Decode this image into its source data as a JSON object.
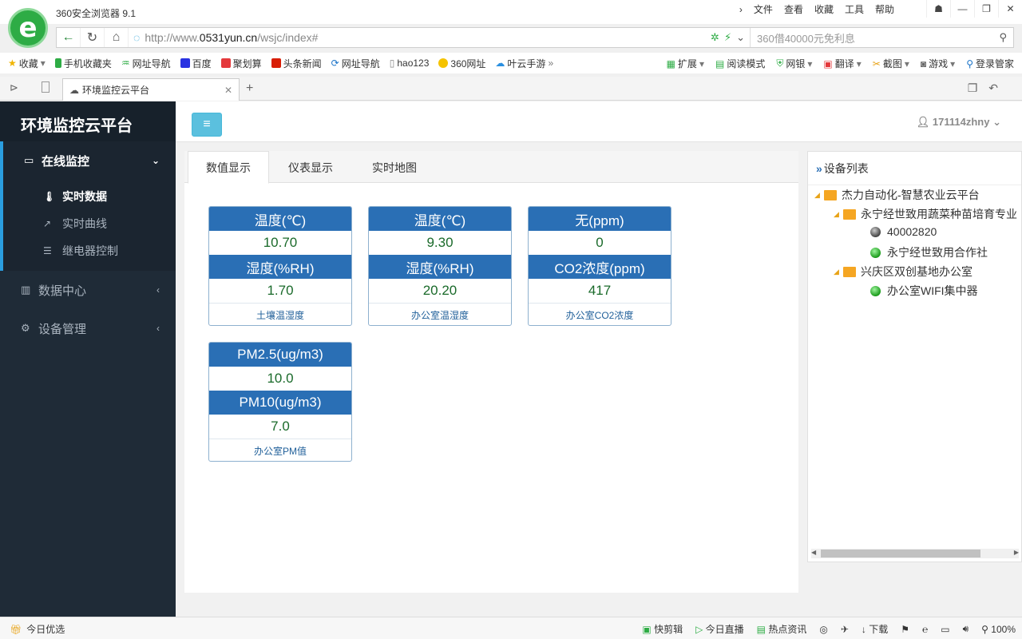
{
  "browser": {
    "title": "360安全浏览器 9.1",
    "menus": [
      "文件",
      "查看",
      "收藏",
      "工具",
      "帮助"
    ],
    "url_prefix": "http://www.",
    "url_host": "0531yun.cn",
    "url_path": "/wsjc/index#",
    "search_placeholder": "360借40000元免利息",
    "bookmarks": [
      "收藏",
      "手机收藏夹",
      "网址导航",
      "百度",
      "聚划算",
      "头条新闻",
      "网址导航",
      "hao123",
      "360网址",
      "叶云手游"
    ],
    "bookmarks_right": [
      "扩展",
      "阅读模式",
      "网银",
      "翻译",
      "截图",
      "游戏",
      "登录管家"
    ],
    "tab_title": "环境监控云平台",
    "status_left": "今日优选",
    "status_items": [
      "快剪辑",
      "今日直播",
      "热点资讯",
      "下载"
    ],
    "zoom": "100%"
  },
  "sidebar": {
    "brand": "环境监控云平台",
    "groups": [
      {
        "label": "在线监控",
        "items": [
          "实时数据",
          "实时曲线",
          "继电器控制"
        ]
      },
      {
        "label": "数据中心"
      },
      {
        "label": "设备管理"
      }
    ]
  },
  "topbar": {
    "user": "171114zhny"
  },
  "main": {
    "tabs": [
      "数值显示",
      "仪表显示",
      "实时地图"
    ],
    "cards": [
      {
        "h1": "温度(℃)",
        "v1": "10.70",
        "h2": "湿度(%RH)",
        "v2": "1.70",
        "name": "土壤温湿度"
      },
      {
        "h1": "温度(℃)",
        "v1": "9.30",
        "h2": "湿度(%RH)",
        "v2": "20.20",
        "name": "办公室温湿度"
      },
      {
        "h1": "无(ppm)",
        "v1": "0",
        "h2": "CO2浓度(ppm)",
        "v2": "417",
        "name": "办公室CO2浓度"
      },
      {
        "h1": "PM2.5(ug/m3)",
        "v1": "10.0",
        "h2": "PM10(ug/m3)",
        "v2": "7.0",
        "name": "办公室PM值"
      }
    ]
  },
  "devices": {
    "title": "设备列表",
    "root": "杰力自动化-智慧农业云平台",
    "group1": "永宁经世致用蔬菜种苗培育专业",
    "dev1": "40002820",
    "dev2": "永宁经世致用合作社",
    "group2": "兴庆区双创基地办公室",
    "dev3": "办公室WIFI集中器"
  }
}
